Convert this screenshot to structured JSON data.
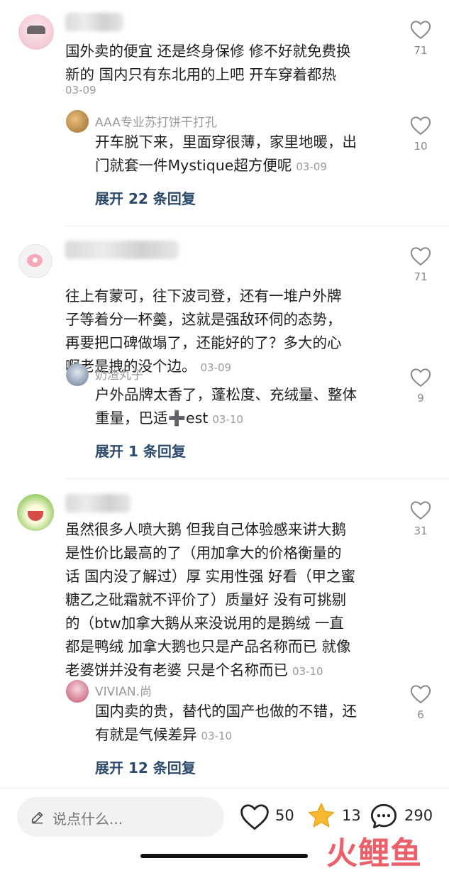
{
  "comments": [
    {
      "text_lines": [
        "国外卖的便宜 还是终身保修 修不好就免费换",
        "新的 国内只有东北用的上吧 开车穿着都热"
      ],
      "date": "03-09",
      "likes": "71",
      "reply": {
        "name": "AAA专业苏打饼干打孔",
        "text_lines": [
          "开车脱下来，里面穿很薄，家里地暖，出",
          "门就套一件Mystique超方便呢"
        ],
        "date": "03-09",
        "likes": "10"
      },
      "expand": "展开 22 条回复"
    },
    {
      "text_lines": [
        "往上有蒙可，往下波司登，还有一堆户外牌",
        "子等着分一杯羹，这就是强敌环伺的态势，",
        "再要把口碑做塌了，还能好的了？多大的心",
        "啊老是拽的没个边。"
      ],
      "date": "03-09",
      "likes": "71",
      "reply": {
        "name": "奶渣丸子",
        "text_lines": [
          "户外品牌太香了，蓬松度、充绒量、整体",
          "重量，巴适➕est"
        ],
        "date": "03-10",
        "likes": "9"
      },
      "expand": "展开 1 条回复"
    },
    {
      "text_lines": [
        "虽然很多人喷大鹅 但我自己体验感来讲大鹅",
        "是性价比最高的了（用加拿大的价格衡量的",
        "话 国内没了解过）厚 实用性强 好看（甲之蜜",
        "糖乙之砒霜就不评价了）质量好 没有可挑剔",
        "的（btw加拿大鹅从来没说用的是鹅绒 一直",
        "都是鸭绒 加拿大鹅也只是产品名称而已 就像",
        "老婆饼并没有老婆 只是个名称而已"
      ],
      "date": "03-10",
      "likes": "31",
      "reply": {
        "name": "VIVIAN.尚",
        "text_lines": [
          "国内卖的贵，替代的国产也做的不错，还",
          "有就是气候差异"
        ],
        "date": "03-10",
        "likes": "6"
      },
      "expand": "展开 12 条回复"
    }
  ],
  "bottom": {
    "placeholder": "说点什么...",
    "likes": "50",
    "favorites": "13",
    "comments": "290"
  },
  "watermark": "火鲤鱼",
  "colors": {
    "accent_blue": "#2c4a6b",
    "star": "#f5b82e",
    "watermark": "#e8505b"
  }
}
